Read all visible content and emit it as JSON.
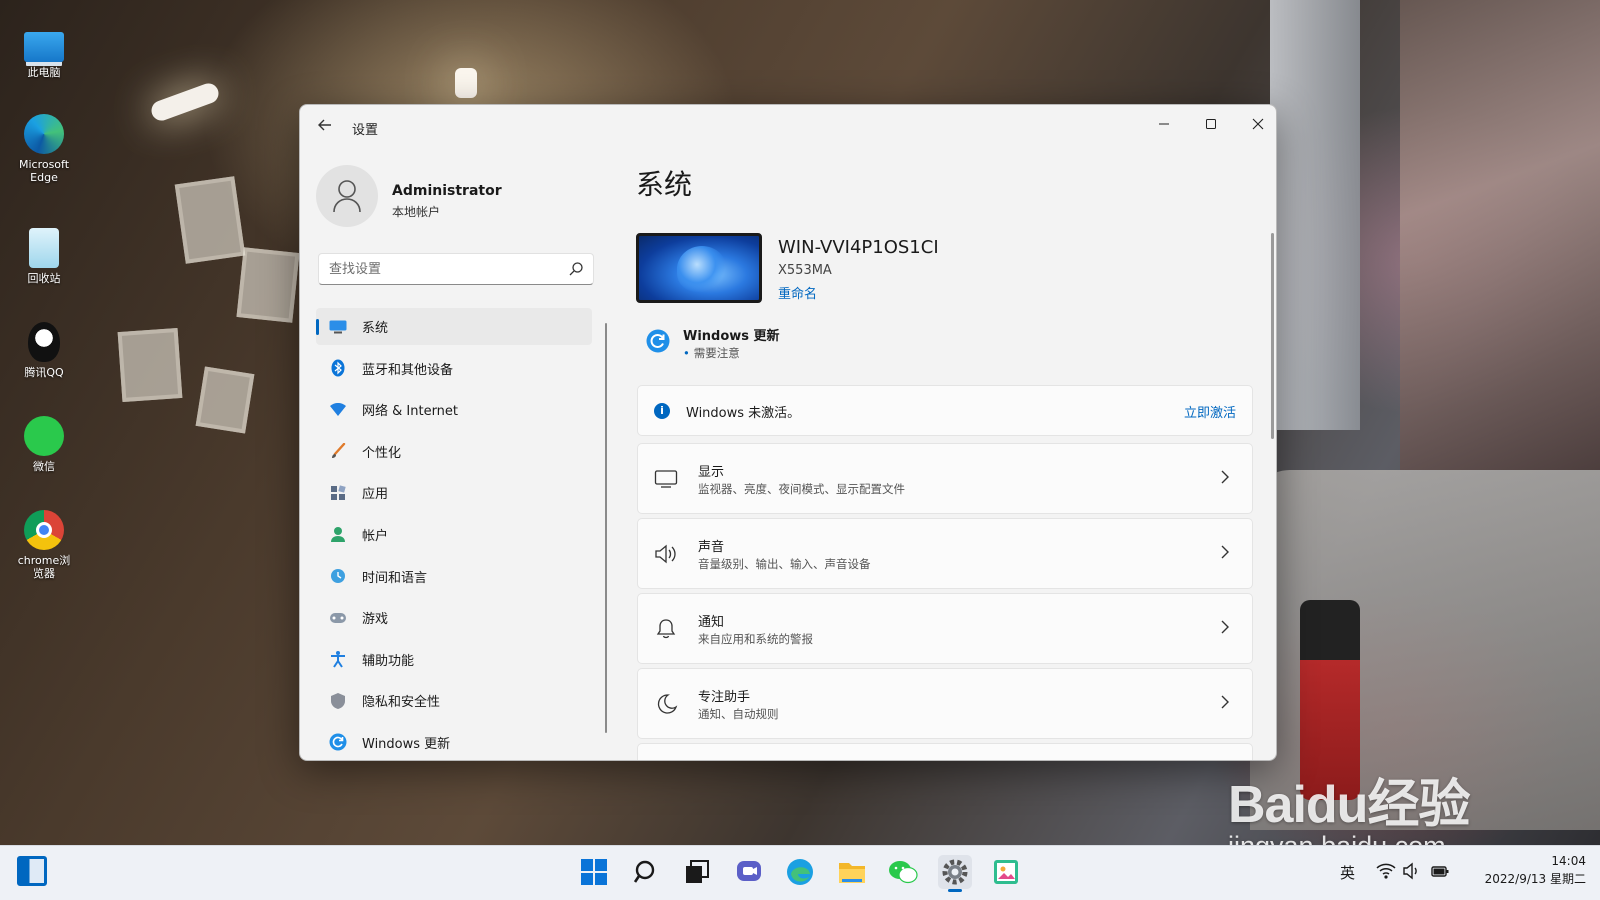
{
  "desktop": {
    "icons": [
      {
        "label": "此电脑",
        "icon": "this-pc-icon"
      },
      {
        "label": "Microsoft Edge",
        "icon": "edge-icon"
      },
      {
        "label": "回收站",
        "icon": "recycle-bin-icon"
      },
      {
        "label": "腾讯QQ",
        "icon": "qq-icon"
      },
      {
        "label": "微信",
        "icon": "wechat-icon"
      },
      {
        "label": "chrome浏览器",
        "icon": "chrome-icon"
      }
    ]
  },
  "window": {
    "title": "设置",
    "controls": {
      "minimize": "—",
      "maximize": "☐",
      "close": "✕"
    }
  },
  "user": {
    "name": "Administrator",
    "account_type": "本地帐户"
  },
  "search": {
    "placeholder": "查找设置"
  },
  "nav": {
    "items": [
      {
        "label": "系统",
        "icon": "system-icon",
        "active": true
      },
      {
        "label": "蓝牙和其他设备",
        "icon": "bluetooth-icon"
      },
      {
        "label": "网络 & Internet",
        "icon": "network-icon"
      },
      {
        "label": "个性化",
        "icon": "personalize-icon"
      },
      {
        "label": "应用",
        "icon": "apps-icon"
      },
      {
        "label": "帐户",
        "icon": "account-icon"
      },
      {
        "label": "时间和语言",
        "icon": "time-language-icon"
      },
      {
        "label": "游戏",
        "icon": "gaming-icon"
      },
      {
        "label": "辅助功能",
        "icon": "accessibility-icon"
      },
      {
        "label": "隐私和安全性",
        "icon": "privacy-icon"
      },
      {
        "label": "Windows 更新",
        "icon": "windows-update-icon"
      }
    ]
  },
  "main": {
    "title": "系统",
    "device": {
      "name": "WIN-VVI4P1OS1CI",
      "model": "X553MA",
      "rename": "重命名"
    },
    "update": {
      "title": "Windows 更新",
      "status": "需要注意"
    },
    "activation": {
      "text": "Windows 未激活。",
      "action": "立即激活"
    },
    "cards": [
      {
        "title": "显示",
        "subtitle": "监视器、亮度、夜间模式、显示配置文件",
        "icon": "display-icon"
      },
      {
        "title": "声音",
        "subtitle": "音量级别、输出、输入、声音设备",
        "icon": "sound-icon"
      },
      {
        "title": "通知",
        "subtitle": "来自应用和系统的警报",
        "icon": "notification-icon"
      },
      {
        "title": "专注助手",
        "subtitle": "通知、自动规则",
        "icon": "focus-assist-icon"
      }
    ]
  },
  "taskbar": {
    "apps": [
      "start-icon",
      "search-icon",
      "task-view-icon",
      "chat-icon",
      "edge-icon",
      "file-explorer-icon",
      "wechat-icon",
      "settings-icon",
      "paint-icon"
    ],
    "active_app": "settings-icon",
    "tray": {
      "lang": "英",
      "time": "14:04",
      "date": "2022/9/13 星期二"
    }
  },
  "watermark": {
    "logo": "Baidu经验",
    "url": "jingyan.baidu.com"
  },
  "colors": {
    "accent": "#0067c0",
    "window_bg": "#f3f3f3",
    "card_bg": "#fbfbfb",
    "taskbar_bg": "#eef1f6"
  }
}
